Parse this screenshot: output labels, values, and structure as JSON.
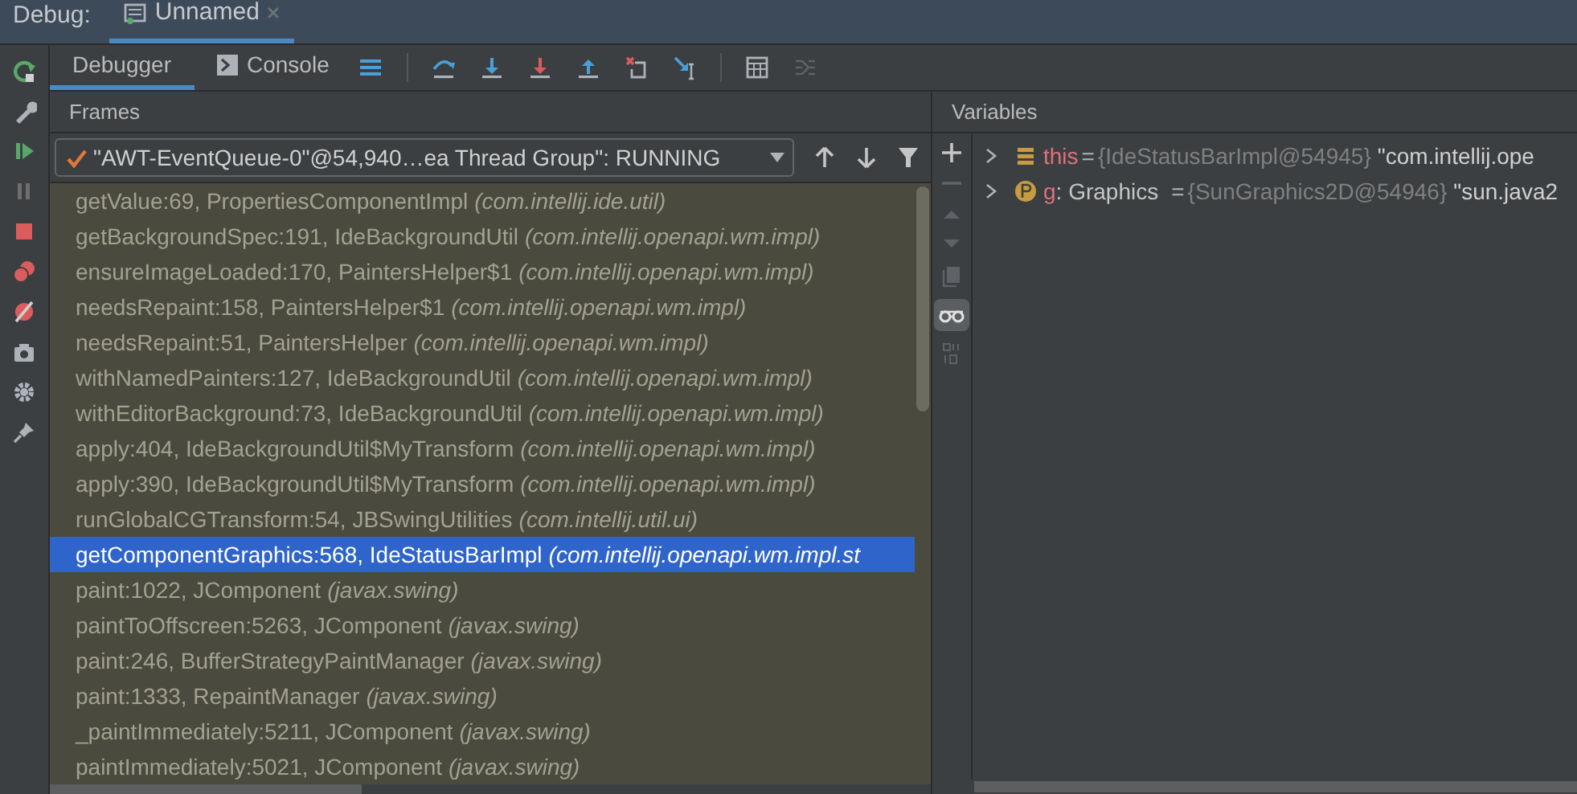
{
  "debug_label": "Debug:",
  "session_tabs": [
    {
      "label": "Unnamed",
      "selected": true
    }
  ],
  "view_tabs": [
    {
      "label": "Debugger",
      "selected": true
    },
    {
      "label": "Console",
      "selected": false
    }
  ],
  "frames_header": "Frames",
  "thread_dropdown": {
    "value": "\"AWT-EventQueue-0\"@54,940…ea Thread Group\": RUNNING"
  },
  "frames": [
    {
      "method": "getValue:69, PropertiesComponentImpl",
      "package": "(com.intellij.ide.util)",
      "selected": false
    },
    {
      "method": "getBackgroundSpec:191, IdeBackgroundUtil",
      "package": "(com.intellij.openapi.wm.impl)",
      "selected": false
    },
    {
      "method": "ensureImageLoaded:170, PaintersHelper$1",
      "package": "(com.intellij.openapi.wm.impl)",
      "selected": false
    },
    {
      "method": "needsRepaint:158, PaintersHelper$1",
      "package": "(com.intellij.openapi.wm.impl)",
      "selected": false
    },
    {
      "method": "needsRepaint:51, PaintersHelper",
      "package": "(com.intellij.openapi.wm.impl)",
      "selected": false
    },
    {
      "method": "withNamedPainters:127, IdeBackgroundUtil",
      "package": "(com.intellij.openapi.wm.impl)",
      "selected": false
    },
    {
      "method": "withEditorBackground:73, IdeBackgroundUtil",
      "package": "(com.intellij.openapi.wm.impl)",
      "selected": false
    },
    {
      "method": "apply:404, IdeBackgroundUtil$MyTransform",
      "package": "(com.intellij.openapi.wm.impl)",
      "selected": false
    },
    {
      "method": "apply:390, IdeBackgroundUtil$MyTransform",
      "package": "(com.intellij.openapi.wm.impl)",
      "selected": false
    },
    {
      "method": "runGlobalCGTransform:54, JBSwingUtilities",
      "package": "(com.intellij.util.ui)",
      "selected": false
    },
    {
      "method": "getComponentGraphics:568, IdeStatusBarImpl",
      "package": "(com.intellij.openapi.wm.impl.st",
      "selected": true
    },
    {
      "method": "paint:1022, JComponent",
      "package": "(javax.swing)",
      "selected": false
    },
    {
      "method": "paintToOffscreen:5263, JComponent",
      "package": "(javax.swing)",
      "selected": false
    },
    {
      "method": "paint:246, BufferStrategyPaintManager",
      "package": "(javax.swing)",
      "selected": false
    },
    {
      "method": "paint:1333, RepaintManager",
      "package": "(javax.swing)",
      "selected": false
    },
    {
      "method": "_paintImmediately:5211, JComponent",
      "package": "(javax.swing)",
      "selected": false
    },
    {
      "method": "paintImmediately:5021, JComponent",
      "package": "(javax.swing)",
      "selected": false
    }
  ],
  "variables_header": "Variables",
  "variables": [
    {
      "kind": "field",
      "name": "this",
      "equals": "=",
      "value": "{IdeStatusBarImpl@54945}",
      "text": "\"com.intellij.ope"
    },
    {
      "kind": "param",
      "name": "g",
      "type": ": Graphics",
      "equals": "=",
      "value": "{SunGraphics2D@54946}",
      "text": "\"sun.java2"
    }
  ]
}
